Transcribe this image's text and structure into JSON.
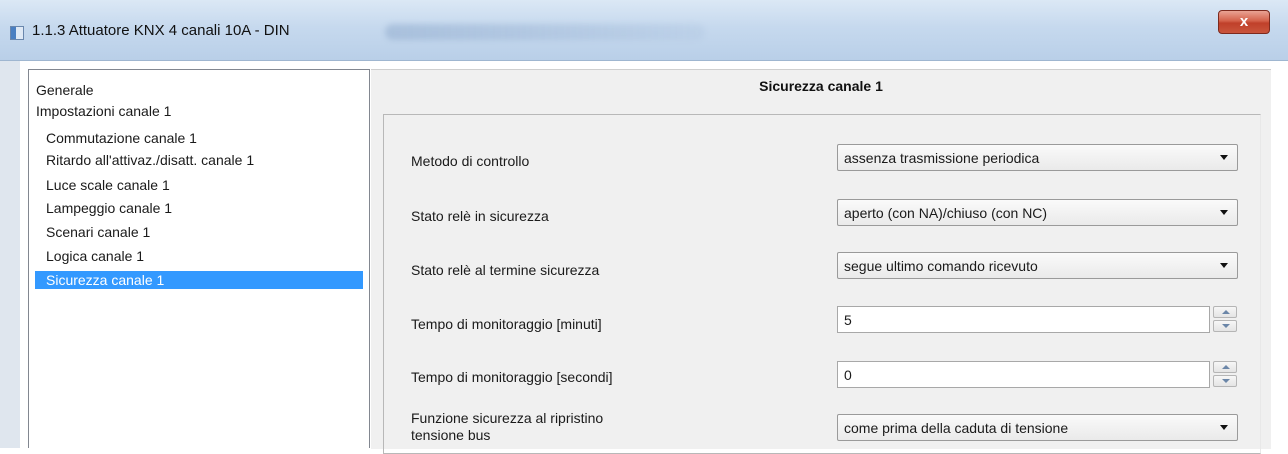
{
  "window": {
    "title": "1.1.3 Attuatore KNX 4 canali 10A - DIN",
    "close_label": "x"
  },
  "tree": {
    "items": [
      {
        "label": "Generale"
      },
      {
        "label": "Impostazioni canale 1"
      },
      {
        "label": "Commutazione canale 1"
      },
      {
        "label": "Ritardo all'attivaz./disatt. canale 1"
      },
      {
        "label": "Luce scale canale 1"
      },
      {
        "label": "Lampeggio canale 1"
      },
      {
        "label": "Scenari canale 1"
      },
      {
        "label": "Logica canale 1"
      },
      {
        "label": "Sicurezza canale 1"
      }
    ],
    "selected": "Sicurezza canale 1"
  },
  "main": {
    "title": "Sicurezza canale 1",
    "params": [
      {
        "label": "Metodo di controllo",
        "type": "select",
        "value": "assenza trasmissione periodica"
      },
      {
        "label": "Stato relè in sicurezza",
        "type": "select",
        "value": "aperto (con NA)/chiuso (con NC)"
      },
      {
        "label": "Stato relè al termine sicurezza",
        "type": "select",
        "value": "segue ultimo comando ricevuto"
      },
      {
        "label": "Tempo di monitoraggio [minuti]",
        "type": "spinner",
        "value": "5"
      },
      {
        "label": "Tempo di monitoraggio [secondi]",
        "type": "spinner",
        "value": "0"
      },
      {
        "label_line1": "Funzione sicurezza al ripristino",
        "label_line2": "tensione bus",
        "type": "select",
        "value": "come prima della caduta di tensione"
      }
    ]
  },
  "colors": {
    "selection": "#3399ff",
    "panel_bg": "#f0f0f0",
    "close_button": "#c9553d"
  }
}
